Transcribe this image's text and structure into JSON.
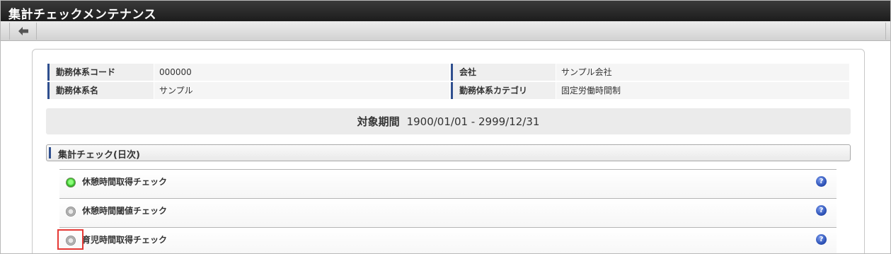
{
  "window": {
    "title": "集計チェックメンテナンス"
  },
  "toolbar": {
    "back_icon": "back-arrow-icon"
  },
  "info": {
    "rows": [
      {
        "label1": "勤務体系コード",
        "value1": "000000",
        "label2": "会社",
        "value2": "サンプル会社"
      },
      {
        "label1": "勤務体系名",
        "value1": "サンプル",
        "label2": "勤務体系カテゴリ",
        "value2": "固定労働時間制"
      }
    ]
  },
  "period": {
    "label": "対象期間",
    "value": "1900/01/01 - 2999/12/31"
  },
  "section": {
    "title": "集計チェック(日次)"
  },
  "checks": [
    {
      "label": "休憩時間取得チェック",
      "selected": true,
      "help": "?"
    },
    {
      "label": "休憩時間閾値チェック",
      "selected": false,
      "help": "?"
    },
    {
      "label": "育児時間取得チェック",
      "selected": false,
      "help": "?"
    }
  ],
  "colors": {
    "accent": "#2f4f8f",
    "title_bar": "#262626",
    "selected_radio": "#3cc22f",
    "highlight": "#e53935"
  }
}
